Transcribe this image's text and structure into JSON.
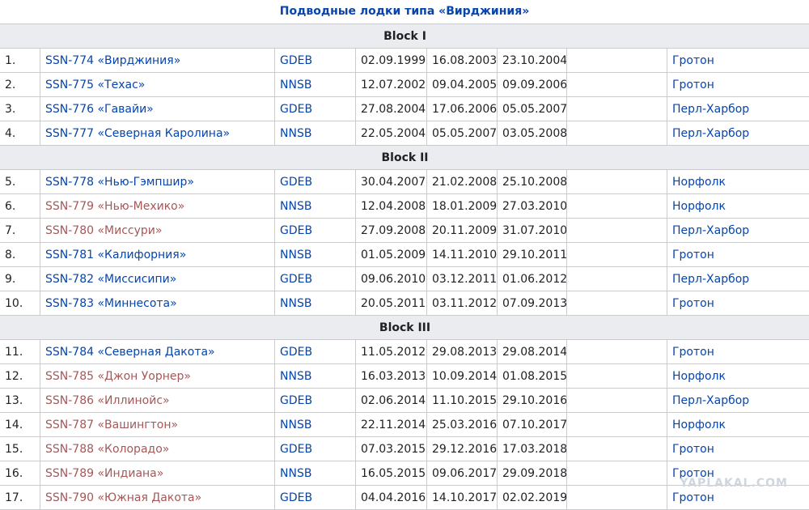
{
  "title": "Подводные лодки типа «Вирджиния»",
  "colors": {
    "link": "#0645ad",
    "redlink": "#a55858",
    "header_bg": "#eaecf0",
    "border": "#c8ccd1"
  },
  "blocks": [
    {
      "name": "Block I",
      "rows": [
        {
          "num": "1.",
          "name": "SSN-774 «Вирджиния»",
          "name_color": "blue",
          "builder": "GDEB",
          "laid": "02.09.1999",
          "launched": "16.08.2003",
          "commissioned": "23.10.2004",
          "status": "",
          "port": "Гротон"
        },
        {
          "num": "2.",
          "name": "SSN-775 «Техас»",
          "name_color": "blue",
          "builder": "NNSB",
          "laid": "12.07.2002",
          "launched": "09.04.2005",
          "commissioned": "09.09.2006",
          "status": "",
          "port": "Гротон"
        },
        {
          "num": "3.",
          "name": "SSN-776 «Гавайи»",
          "name_color": "blue",
          "builder": "GDEB",
          "laid": "27.08.2004",
          "launched": "17.06.2006",
          "commissioned": "05.05.2007",
          "status": "",
          "port": "Перл-Харбор"
        },
        {
          "num": "4.",
          "name": "SSN-777 «Северная Каролина»",
          "name_color": "blue",
          "builder": "NNSB",
          "laid": "22.05.2004",
          "launched": "05.05.2007",
          "commissioned": "03.05.2008",
          "status": "",
          "port": "Перл-Харбор"
        }
      ]
    },
    {
      "name": "Block II",
      "rows": [
        {
          "num": "5.",
          "name": "SSN-778 «Нью-Гэмпшир»",
          "name_color": "blue",
          "builder": "GDEB",
          "laid": "30.04.2007",
          "launched": "21.02.2008",
          "commissioned": "25.10.2008",
          "status": "",
          "port": "Норфолк"
        },
        {
          "num": "6.",
          "name": "SSN-779 «Нью-Мехико»",
          "name_color": "red",
          "builder": "NNSB",
          "laid": "12.04.2008",
          "launched": "18.01.2009",
          "commissioned": "27.03.2010",
          "status": "",
          "port": "Норфолк"
        },
        {
          "num": "7.",
          "name": "SSN-780 «Миссури»",
          "name_color": "red",
          "builder": "GDEB",
          "laid": "27.09.2008",
          "launched": "20.11.2009",
          "commissioned": "31.07.2010",
          "status": "",
          "port": "Перл-Харбор"
        },
        {
          "num": "8.",
          "name": "SSN-781 «Калифорния»",
          "name_color": "blue",
          "builder": "NNSB",
          "laid": "01.05.2009",
          "launched": "14.11.2010",
          "commissioned": "29.10.2011",
          "status": "",
          "port": "Гротон"
        },
        {
          "num": "9.",
          "name": "SSN-782 «Миссисипи»",
          "name_color": "blue",
          "builder": "GDEB",
          "laid": "09.06.2010",
          "launched": "03.12.2011",
          "commissioned": "01.06.2012",
          "status": "",
          "port": "Перл-Харбор"
        },
        {
          "num": "10.",
          "name": "SSN-783 «Миннесота»",
          "name_color": "blue",
          "builder": "NNSB",
          "laid": "20.05.2011",
          "launched": "03.11.2012",
          "commissioned": "07.09.2013",
          "status": "",
          "port": "Гротон"
        }
      ]
    },
    {
      "name": "Block III",
      "rows": [
        {
          "num": "11.",
          "name": "SSN-784 «Северная Дакота»",
          "name_color": "blue",
          "builder": "GDEB",
          "laid": "11.05.2012",
          "launched": "29.08.2013",
          "commissioned": "29.08.2014",
          "status": "",
          "port": "Гротон"
        },
        {
          "num": "12.",
          "name": "SSN-785 «Джон Уорнер»",
          "name_color": "red",
          "builder": "NNSB",
          "laid": "16.03.2013",
          "launched": "10.09.2014",
          "commissioned": "01.08.2015",
          "status": "",
          "port": "Норфолк"
        },
        {
          "num": "13.",
          "name": "SSN-786 «Иллинойс»",
          "name_color": "red",
          "builder": "GDEB",
          "laid": "02.06.2014",
          "launched": "11.10.2015",
          "commissioned": "29.10.2016",
          "status": "",
          "port": "Перл-Харбор"
        },
        {
          "num": "14.",
          "name": "SSN-787 «Вашингтон»",
          "name_color": "red",
          "builder": "NNSB",
          "laid": "22.11.2014",
          "launched": "25.03.2016",
          "commissioned": "07.10.2017",
          "status": "",
          "port": "Норфолк"
        },
        {
          "num": "15.",
          "name": "SSN-788 «Колорадо»",
          "name_color": "red",
          "builder": "GDEB",
          "laid": "07.03.2015",
          "launched": "29.12.2016",
          "commissioned": "17.03.2018",
          "status": "",
          "port": "Гротон"
        },
        {
          "num": "16.",
          "name": "SSN-789 «Индиана»",
          "name_color": "red",
          "builder": "NNSB",
          "laid": "16.05.2015",
          "launched": "09.06.2017",
          "commissioned": "29.09.2018",
          "status": "",
          "port": "Гротон"
        },
        {
          "num": "17.",
          "name": "SSN-790 «Южная Дакота»",
          "name_color": "red",
          "builder": "GDEB",
          "laid": "04.04.2016",
          "launched": "14.10.2017",
          "commissioned": "02.02.2019",
          "status": "",
          "port": "Гротон"
        }
      ]
    }
  ],
  "watermark": "YAPLAKAL.COM"
}
